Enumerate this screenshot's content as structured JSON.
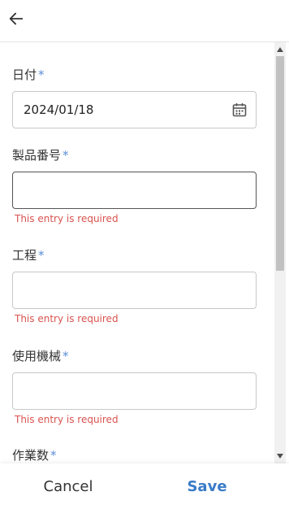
{
  "header": {
    "back_icon": "arrow-left-icon"
  },
  "form": {
    "fields": [
      {
        "label": "日付",
        "required_mark": "*",
        "value": "2024/01/18",
        "icon": "calendar-icon",
        "error": ""
      },
      {
        "label": "製品番号",
        "required_mark": "*",
        "value": "",
        "error": "This entry is required"
      },
      {
        "label": "工程",
        "required_mark": "*",
        "value": "",
        "error": "This entry is required"
      },
      {
        "label": "使用機械",
        "required_mark": "*",
        "value": "",
        "error": "This entry is required"
      },
      {
        "label": "作業数",
        "required_mark": "*",
        "value": "",
        "error": ""
      }
    ]
  },
  "footer": {
    "cancel_label": "Cancel",
    "save_label": "Save"
  },
  "colors": {
    "accent": "#3a7bc8",
    "required": "#5b8dd6",
    "error": "#d9534f"
  }
}
